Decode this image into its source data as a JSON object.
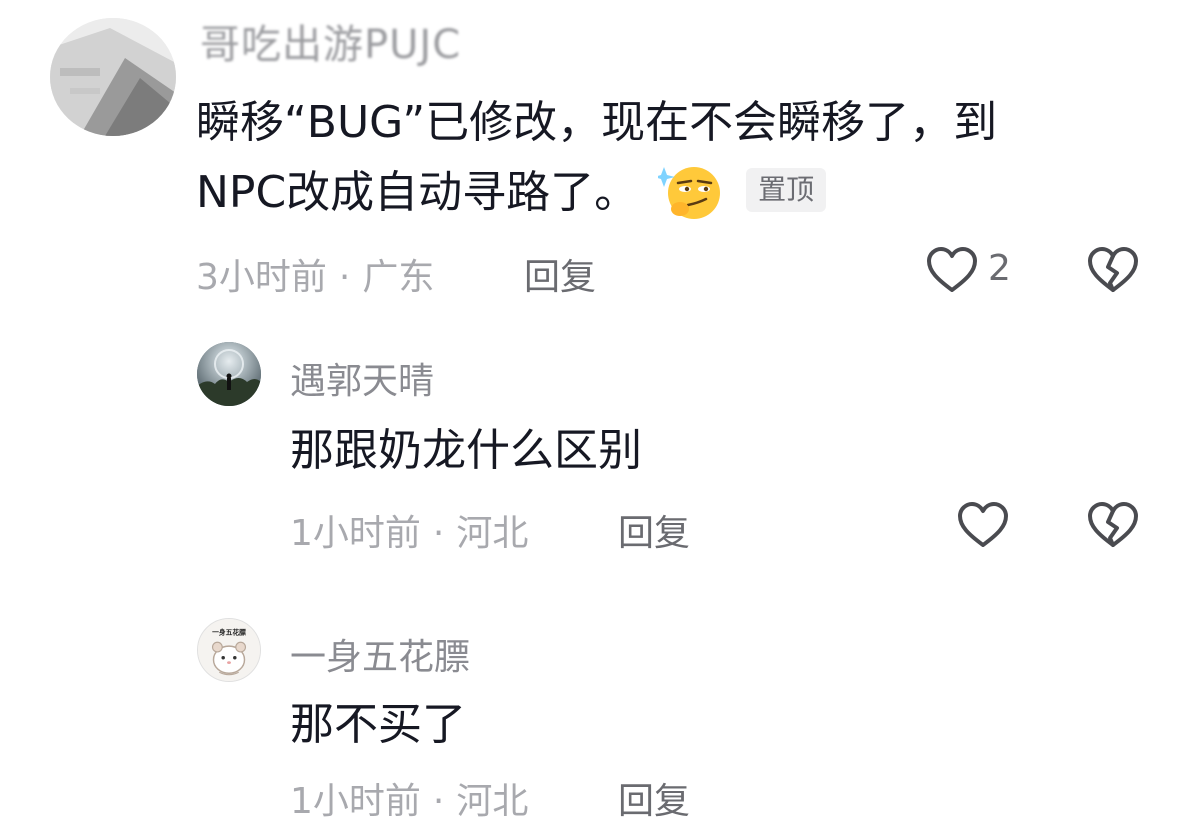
{
  "comments": [
    {
      "username": "哥吃出游PUJC",
      "text_line1": "瞬移“BUG”已修改，现在不会瞬移了，到",
      "text_line2": "NPC改成自动寻路了。",
      "badge": "置顶",
      "time": "3小时前",
      "location": "广东",
      "reply": "回复",
      "likes": "2"
    },
    {
      "username": "遇郭天晴",
      "text": "那跟奶龙什么区别",
      "time": "1小时前",
      "location": "河北",
      "reply": "回复"
    },
    {
      "username": "一身五花膘",
      "avatar_text": "一身五花膘",
      "text": "那不买了",
      "time": "1小时前",
      "location": "河北",
      "reply": "回复"
    }
  ],
  "separator": "·",
  "icons": {
    "like": "heart-outline-icon",
    "dislike": "broken-heart-icon",
    "emoji": "smirk-emoji-icon"
  },
  "colors": {
    "text": "#161823",
    "meta": "#a8a9ae",
    "username": "#8a8b91",
    "icon": "#4a4b50"
  }
}
